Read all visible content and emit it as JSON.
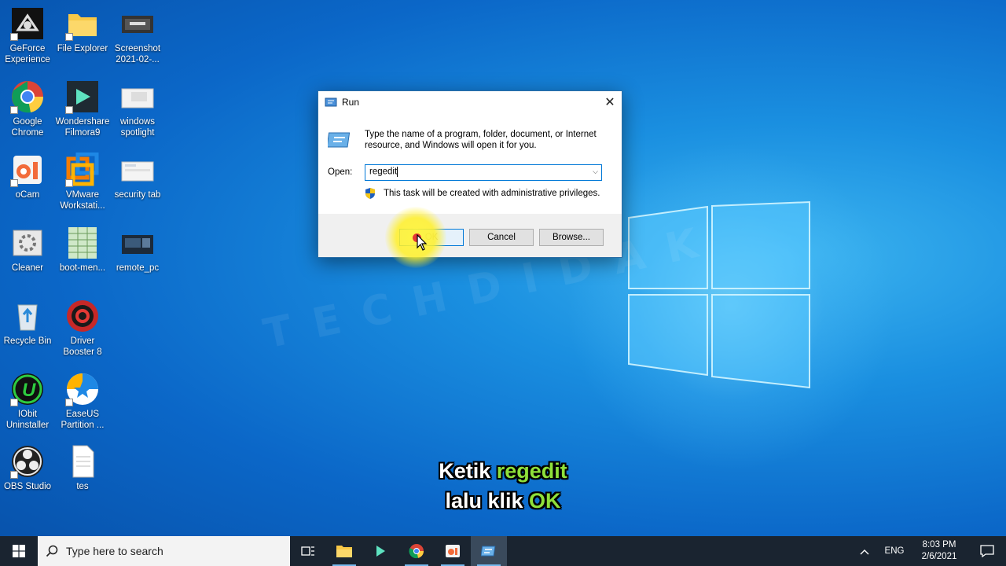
{
  "desktop": {
    "icons": [
      {
        "label": "GeForce Experience",
        "icon": "geforce-icon"
      },
      {
        "label": "File Explorer",
        "icon": "folder-icon"
      },
      {
        "label": "Screenshot 2021-02-...",
        "icon": "screenshot-file-icon"
      },
      {
        "label": "Google Chrome",
        "icon": "chrome-icon"
      },
      {
        "label": "Wondershare Filmora9",
        "icon": "filmora-icon"
      },
      {
        "label": "windows spotlight",
        "icon": "image-file-icon"
      },
      {
        "label": "oCam",
        "icon": "ocam-icon"
      },
      {
        "label": "VMware Workstati...",
        "icon": "vmware-icon"
      },
      {
        "label": "security tab",
        "icon": "image-file-icon"
      },
      {
        "label": "Cleaner",
        "icon": "cleaner-icon"
      },
      {
        "label": "boot-men...",
        "icon": "spreadsheet-file-icon"
      },
      {
        "label": "remote_pc",
        "icon": "image-file-icon"
      },
      {
        "label": "Recycle Bin",
        "icon": "recycle-bin-icon"
      },
      {
        "label": "Driver Booster 8",
        "icon": "driver-booster-icon"
      },
      {
        "label": "IObit Uninstaller",
        "icon": "iobit-uninstaller-icon"
      },
      {
        "label": "EaseUS Partition ...",
        "icon": "easeus-icon"
      },
      {
        "label": "OBS Studio",
        "icon": "obs-icon"
      },
      {
        "label": "tes",
        "icon": "text-file-icon"
      }
    ],
    "watermark": "TECHDIDAK"
  },
  "run_dialog": {
    "title": "Run",
    "close_glyph": "✕",
    "description": "Type the name of a program, folder, document, or Internet resource, and Windows will open it for you.",
    "open_label": "Open:",
    "input_value": "regedit",
    "admin_note": "This task will be created with administrative privileges.",
    "ok_label": "OK",
    "cancel_label": "Cancel",
    "browse_label": "Browse..."
  },
  "captions": {
    "line1_prefix": "Ketik ",
    "line1_highlight": "regedit",
    "line2_prefix": "lalu klik ",
    "line2_highlight": "OK"
  },
  "taskbar": {
    "search_placeholder": "Type here to search",
    "apps": [
      "task-view-icon",
      "file-explorer-icon",
      "filmora-icon",
      "chrome-icon",
      "ocam-icon",
      "run-icon"
    ],
    "language": "ENG",
    "time": "8:03 PM",
    "date": "2/6/2021"
  },
  "colors": {
    "desktop_blue": "#0b67c8",
    "dialog_border": "#2b6ea6",
    "caption_highlight": "#8ee03a",
    "taskbar": "#1a2430",
    "accent": "#0078d7"
  }
}
